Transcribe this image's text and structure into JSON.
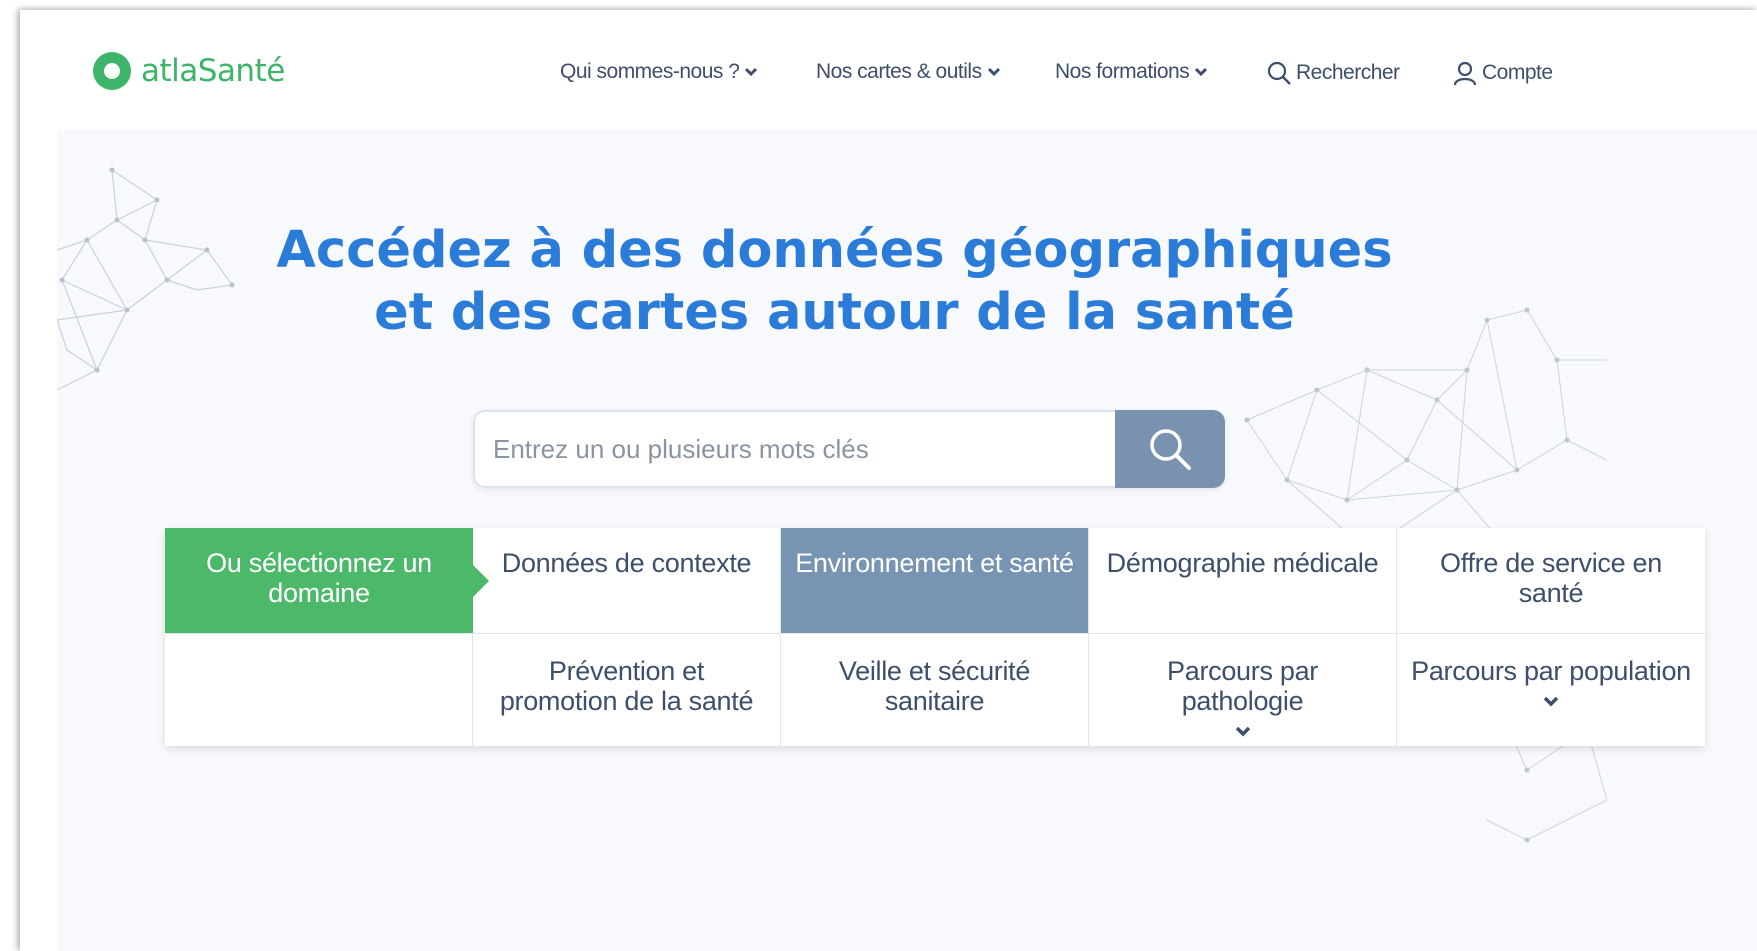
{
  "brand": {
    "name": "atlaSanté",
    "color": "#3cb56a"
  },
  "nav": {
    "items": [
      {
        "label": "Qui sommes-nous ?",
        "icon": "chevron-down-icon"
      },
      {
        "label": "Nos cartes & outils",
        "icon": "chevron-down-icon"
      },
      {
        "label": "Nos formations",
        "icon": "chevron-down-icon"
      }
    ],
    "search": {
      "label": "Rechercher",
      "icon": "search-icon"
    },
    "account": {
      "label": "Compte",
      "icon": "user-icon"
    }
  },
  "hero": {
    "title_line1": "Accédez à des données géographiques",
    "title_line2": "et des cartes autour de la santé",
    "title_color": "#2b7bd9"
  },
  "search": {
    "placeholder": "Entrez un ou plusieurs mots clés",
    "value": "",
    "button_icon": "search-icon",
    "button_color": "#7892b0"
  },
  "domains": {
    "prompt": "Ou sélectionnez un domaine",
    "prompt_color": "#4cb96a",
    "active_color": "#7894b3",
    "row1": [
      {
        "label": "Données de contexte",
        "active": false
      },
      {
        "label": "Environnement et santé",
        "active": true
      },
      {
        "label": "Démographie médicale",
        "active": false
      },
      {
        "label": "Offre de service en santé",
        "active": false
      }
    ],
    "row2": [
      {
        "label": "Prévention et promotion de la santé",
        "expandable": false
      },
      {
        "label": "Veille et sécurité sanitaire",
        "expandable": false
      },
      {
        "label": "Parcours par pathologie",
        "expandable": true
      },
      {
        "label": "Parcours par population",
        "expandable": true
      }
    ]
  }
}
